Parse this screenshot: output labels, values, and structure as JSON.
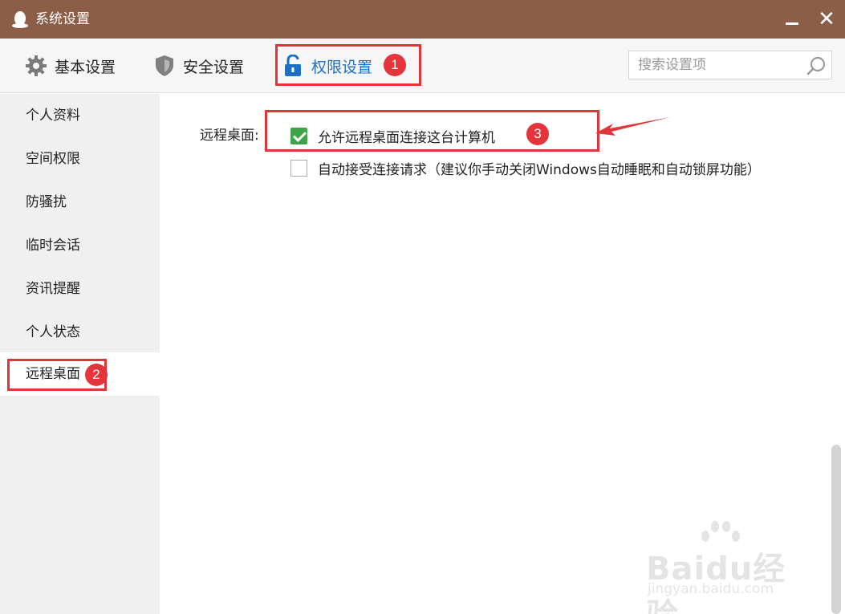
{
  "window": {
    "title": "系统设置",
    "minimize_icon": "minimize-icon",
    "close_label": "✕"
  },
  "toolbar": {
    "tabs": [
      {
        "label": "基本设置",
        "icon": "gear-icon"
      },
      {
        "label": "安全设置",
        "icon": "shield-icon"
      },
      {
        "label": "权限设置",
        "icon": "lock-icon"
      }
    ],
    "active_tab": "权限设置",
    "search_placeholder": "搜索设置项"
  },
  "sidebar": {
    "items": [
      {
        "label": "个人资料"
      },
      {
        "label": "空间权限"
      },
      {
        "label": "防骚扰"
      },
      {
        "label": "临时会话"
      },
      {
        "label": "资讯提醒"
      },
      {
        "label": "个人状态"
      },
      {
        "label": "远程桌面"
      }
    ],
    "active_item": "远程桌面"
  },
  "content": {
    "section_label": "远程桌面:",
    "options": [
      {
        "label": "允许远程桌面连接这台计算机",
        "checked": true
      },
      {
        "label": "自动接受连接请求（建议你手动关闭Windows自动睡眠和自动锁屏功能）",
        "checked": false
      }
    ]
  },
  "annotations": {
    "badges": [
      "1",
      "2",
      "3"
    ],
    "highlight_color": "#e0353b"
  },
  "watermark": {
    "text": "Baidu经验",
    "sub": "jingyan.baidu.com"
  },
  "colors": {
    "titlebar": "#8c5e47",
    "active_tab": "#1c6fc4",
    "check": "#3fa34a"
  }
}
